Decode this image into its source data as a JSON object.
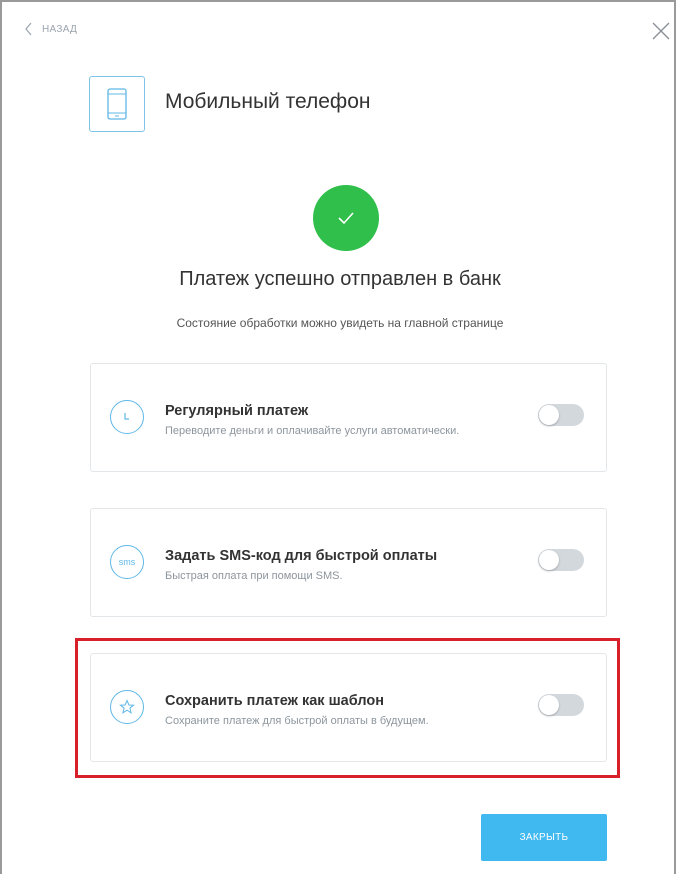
{
  "nav": {
    "back_label": "НАЗАД"
  },
  "service": {
    "title": "Мобильный телефон",
    "icon": "mobile-phone-icon"
  },
  "status": {
    "icon": "check-icon",
    "color": "#2fbf4a",
    "headline": "Платеж успешно отправлен в банк",
    "subline": "Состояние обработки можно увидеть на главной странице"
  },
  "options": [
    {
      "title": "Регулярный платеж",
      "description": "Переводите деньги и оплачивайте услуги автоматически.",
      "icon": "clock-icon",
      "enabled": false
    },
    {
      "title": "Задать SMS-код для быстрой оплаты",
      "description": "Быстрая оплата при помощи SMS.",
      "icon": "sms-icon",
      "icon_text": "sms",
      "enabled": false
    },
    {
      "title": "Сохранить платеж как шаблон",
      "description": "Сохраните платеж для быстрой оплаты в будущем.",
      "icon": "star-icon",
      "enabled": false
    }
  ],
  "footer": {
    "close_label": "ЗАКРЫТЬ"
  },
  "colors": {
    "accent": "#40b8f0",
    "icon_outline": "#5fb8e6",
    "highlight": "#d8202a",
    "toggle_off": "#d3d8dd"
  }
}
